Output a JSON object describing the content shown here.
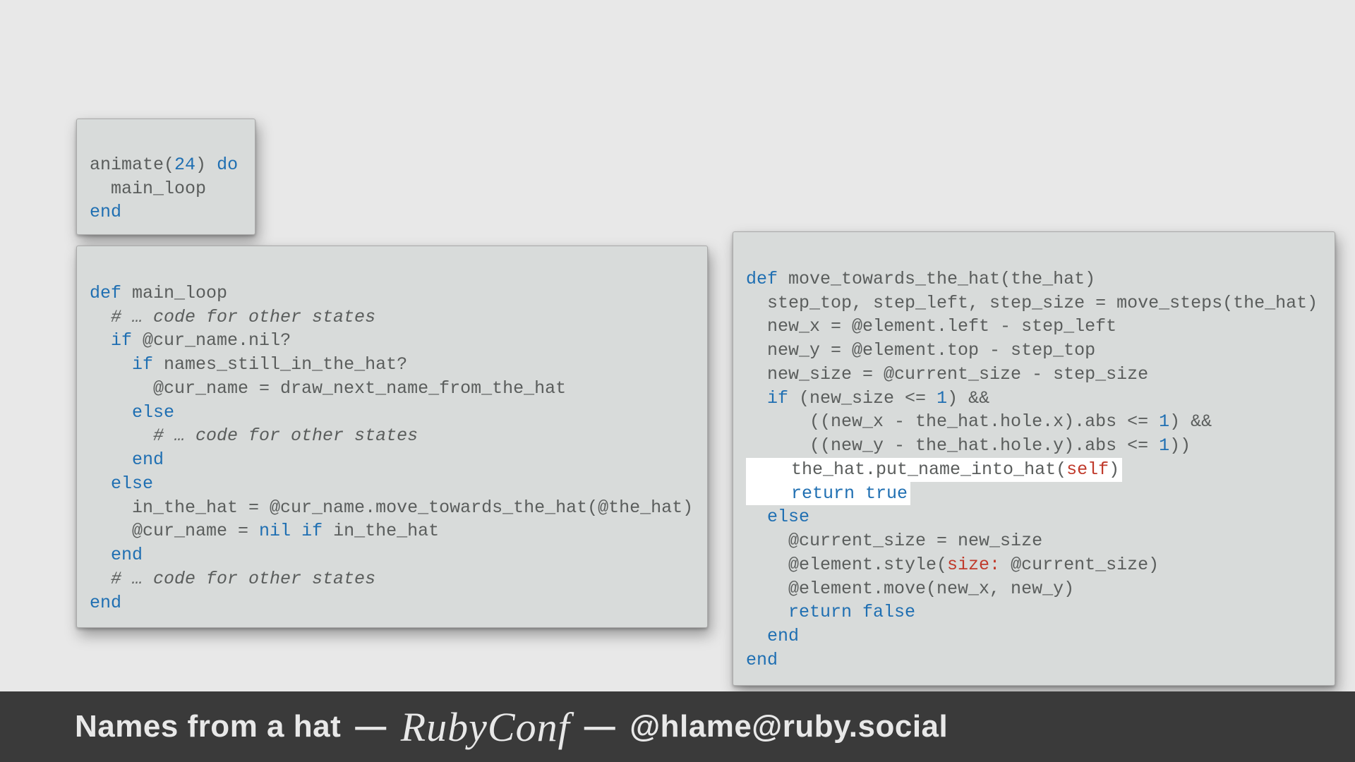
{
  "card1": {
    "l1": {
      "a": "animate(",
      "b": "24",
      "c": ") ",
      "d": "do"
    },
    "l2": "  main_loop",
    "l3": "end"
  },
  "card2": {
    "l1": {
      "a": "def",
      "b": " main_loop"
    },
    "l2": "  # … code for other states",
    "l3": {
      "a": "  ",
      "b": "if",
      "c": " @cur_name.nil?"
    },
    "l4": {
      "a": "    ",
      "b": "if",
      "c": " names_still_in_the_hat?"
    },
    "l5": "      @cur_name = draw_next_name_from_the_hat",
    "l6": {
      "a": "    ",
      "b": "else"
    },
    "l7": "      # … code for other states",
    "l8": {
      "a": "    ",
      "b": "end"
    },
    "l9": {
      "a": "  ",
      "b": "else"
    },
    "l10": "    in_the_hat = @cur_name.move_towards_the_hat(@the_hat)",
    "l11": {
      "a": "    @cur_name = ",
      "b": "nil",
      "c": " ",
      "d": "if",
      "e": " in_the_hat"
    },
    "l12": {
      "a": "  ",
      "b": "end"
    },
    "l13": "  # … code for other states",
    "l14": "end"
  },
  "card3": {
    "l1": {
      "a": "def",
      "b": " move_towards_the_hat(the_hat)"
    },
    "l2": "  step_top, step_left, step_size = move_steps(the_hat)",
    "l3": "  new_x = @element.left - step_left",
    "l4": "  new_y = @element.top - step_top",
    "l5": "  new_size = @current_size - step_size",
    "l6": {
      "a": "  ",
      "b": "if",
      "c": " (new_size <= ",
      "d": "1",
      "e": ") &&"
    },
    "l7": {
      "a": "      ((new_x - the_hat.hole.x).abs <= ",
      "b": "1",
      "c": ") &&"
    },
    "l8": {
      "a": "      ((new_y - the_hat.hole.y).abs <= ",
      "b": "1",
      "c": "))"
    },
    "l9": {
      "a": "    the_hat.put_name_into_hat(",
      "b": "self",
      "c": ")"
    },
    "l10": {
      "a": "    ",
      "b": "return",
      "c": " ",
      "d": "true"
    },
    "l11": {
      "a": "  ",
      "b": "else"
    },
    "l12": "    @current_size = new_size",
    "l13": {
      "a": "    @element.style(",
      "b": "size:",
      "c": " @current_size)"
    },
    "l14": "    @element.move(new_x, new_y)",
    "l15": {
      "a": "    ",
      "b": "return",
      "c": " ",
      "d": "false"
    },
    "l16": {
      "a": "  ",
      "b": "end"
    },
    "l17": "end"
  },
  "footer": {
    "title": "Names from a hat",
    "sep": "—",
    "conf": "RubyConf",
    "handle": "@hlame@ruby.social"
  }
}
